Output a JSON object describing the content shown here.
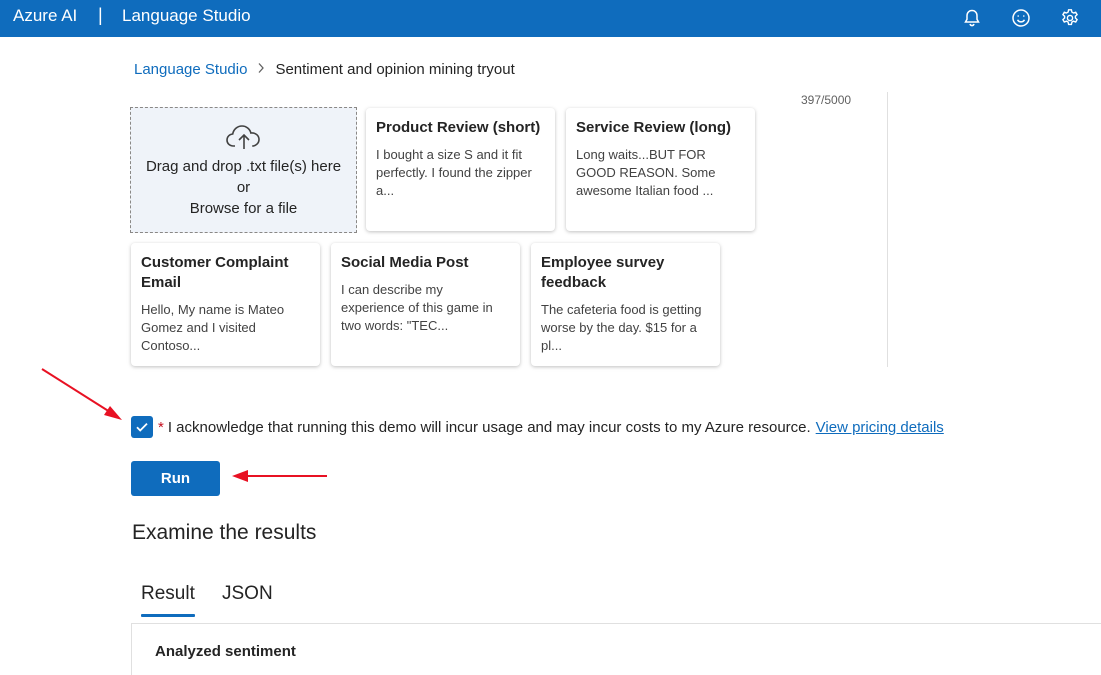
{
  "header": {
    "brand": "Azure AI",
    "separator": "|",
    "product": "Language Studio",
    "icons": [
      "bell-icon",
      "smiley-icon",
      "gear-icon"
    ]
  },
  "breadcrumb": {
    "link": "Language Studio",
    "current": "Sentiment and opinion mining tryout"
  },
  "char_count": "397/5000",
  "upload": {
    "icon": "cloud-upload-icon",
    "line1": "Drag and drop .txt file(s) here",
    "line2": "or",
    "line3": "Browse for a file"
  },
  "samples": [
    {
      "title": "Product Review (short)",
      "body": "I bought a size S and it fit perfectly. I found the zipper a..."
    },
    {
      "title": "Service Review (long)",
      "body": "Long waits...BUT FOR GOOD REASON. Some awesome Italian food ..."
    },
    {
      "title": "Customer Complaint Email",
      "body": "Hello, My name is Mateo Gomez and I visited Contoso..."
    },
    {
      "title": "Social Media Post",
      "body": "I can describe my experience of this game in two words: \"TEC..."
    },
    {
      "title": "Employee survey feedback",
      "body": "The cafeteria food is getting worse by the day. $15 for a pl..."
    }
  ],
  "acknowledge": {
    "checked": true,
    "required_mark": "*",
    "text": "I acknowledge that running this demo will incur usage and may incur costs to my Azure resource.",
    "link": "View pricing details"
  },
  "run_button": "Run",
  "results": {
    "title": "Examine the results",
    "tabs": [
      "Result",
      "JSON"
    ],
    "active_tab": "Result",
    "section_label": "Analyzed sentiment"
  },
  "colors": {
    "accent": "#0f6cbd",
    "annotation": "#e81123"
  }
}
